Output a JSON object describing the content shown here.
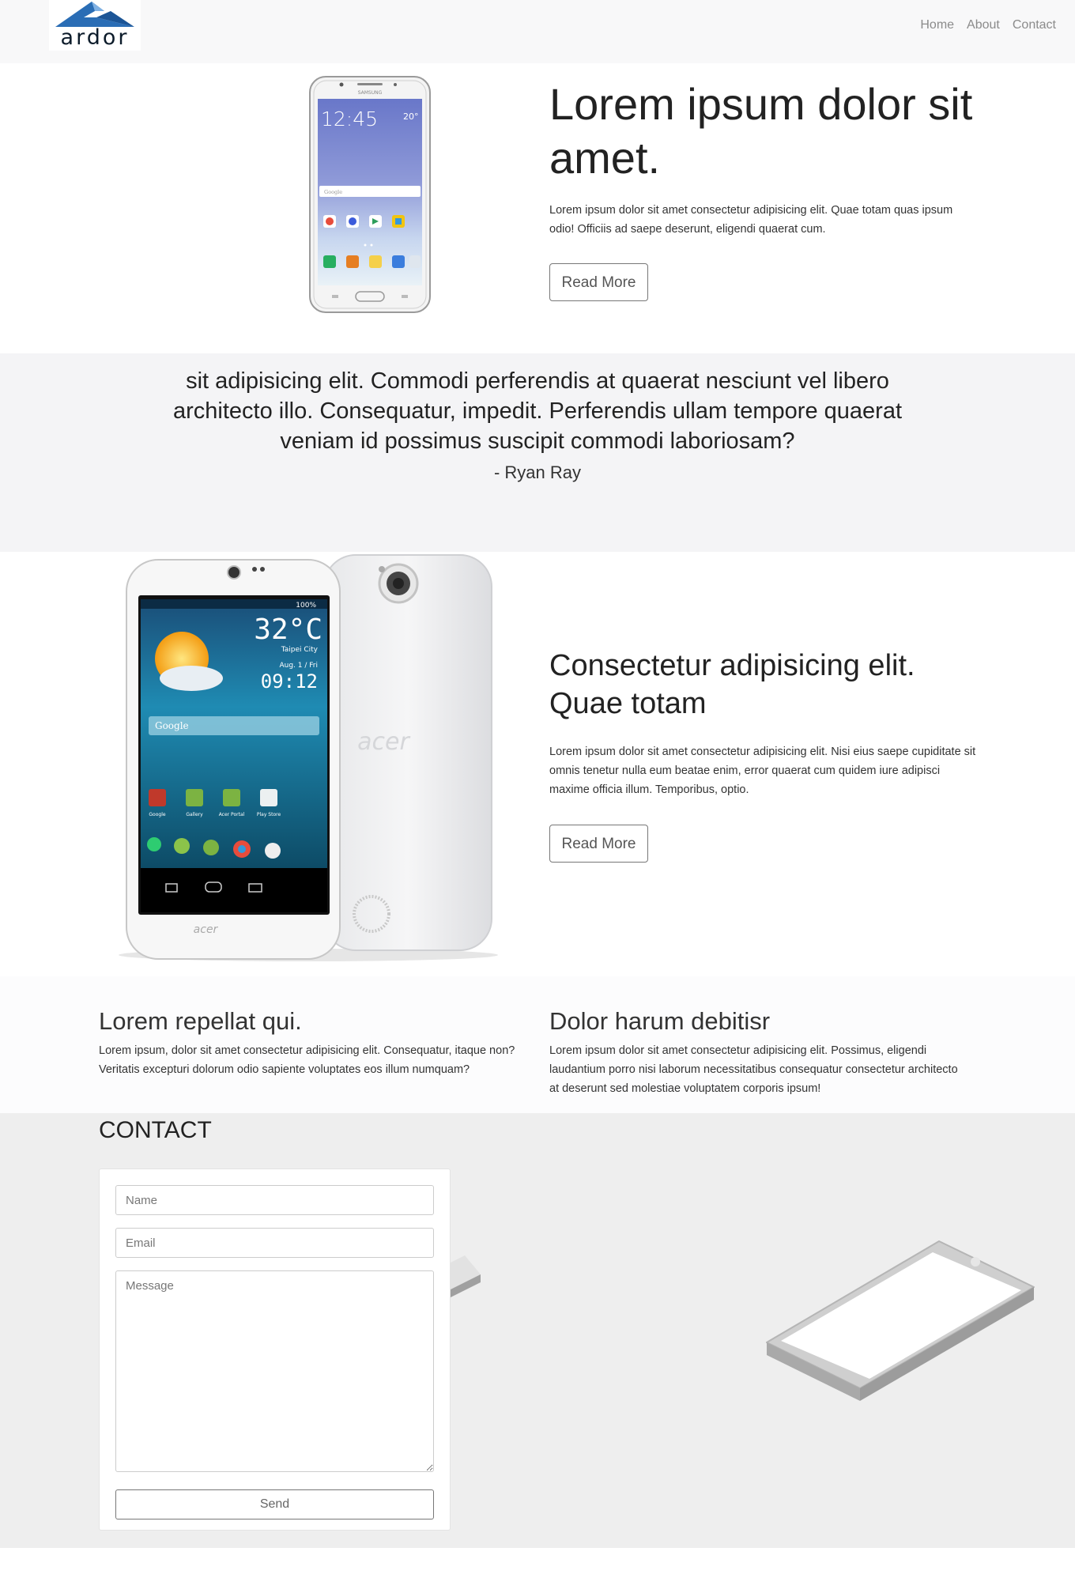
{
  "brand": {
    "logo_text": "ardor"
  },
  "nav": {
    "links": [
      "Home",
      "About",
      "Contact"
    ]
  },
  "hero": {
    "title": "Lorem ipsum dolor sit amet.",
    "text": "Lorem ipsum dolor sit amet consectetur adipisicing elit. Quae totam quas ipsum odio! Officiis ad saepe deserunt, eligendi quaerat cum.",
    "button_label": "Read More",
    "phone": {
      "brand": "SAMSUNG",
      "time": "12:45",
      "temp": "20°",
      "search_placeholder": "Google"
    }
  },
  "quote": {
    "text": "sit adipisicing elit. Commodi perferendis at quaerat nesciunt vel libero architecto illo. Consequatur, impedit. Perferendis ullam tempore quaerat veniam id possimus suscipit commodi laboriosam?",
    "author": "- Ryan Ray"
  },
  "feature2": {
    "title": "Consectetur adipisicing elit. Quae totam",
    "text": "Lorem ipsum dolor sit amet consectetur adipisicing elit. Nisi eius saepe cupiditate sit omnis tenetur nulla eum beatae enim, error quaerat cum quidem iure adipisci maxime officia illum. Temporibus, optio.",
    "button_label": "Read More",
    "phone": {
      "temp": "32°C",
      "city": "Taipei City",
      "date": "Aug. 1 / Fri",
      "time": "09:12",
      "battery": "100%",
      "search_label": "Google",
      "brand": "acer",
      "apps": [
        "Google",
        "Gallery",
        "Acer Portal",
        "Play Store"
      ]
    }
  },
  "columns": [
    {
      "title": "Lorem repellat qui.",
      "text": "Lorem ipsum, dolor sit amet consectetur adipisicing elit. Consequatur, itaque non? Veritatis excepturi dolorum odio sapiente voluptates eos illum numquam?"
    },
    {
      "title": "Dolor harum debitisr",
      "text": "Lorem ipsum dolor sit amet consectetur adipisicing elit. Possimus, eligendi laudantium porro nisi laborum necessitatibus consequatur consectetur architecto at deserunt sed molestiae voluptatem corporis ipsum!"
    }
  ],
  "contact": {
    "title": "CONTACT",
    "name_placeholder": "Name",
    "email_placeholder": "Email",
    "message_placeholder": "Message",
    "send_label": "Send"
  },
  "colors": {
    "logo_blue": "#2a6db5",
    "logo_dark": "#0c1b2a",
    "nav_link": "#8b8b8b",
    "quote_bg": "#f4f4f6",
    "contact_bg": "#eeeeee"
  }
}
